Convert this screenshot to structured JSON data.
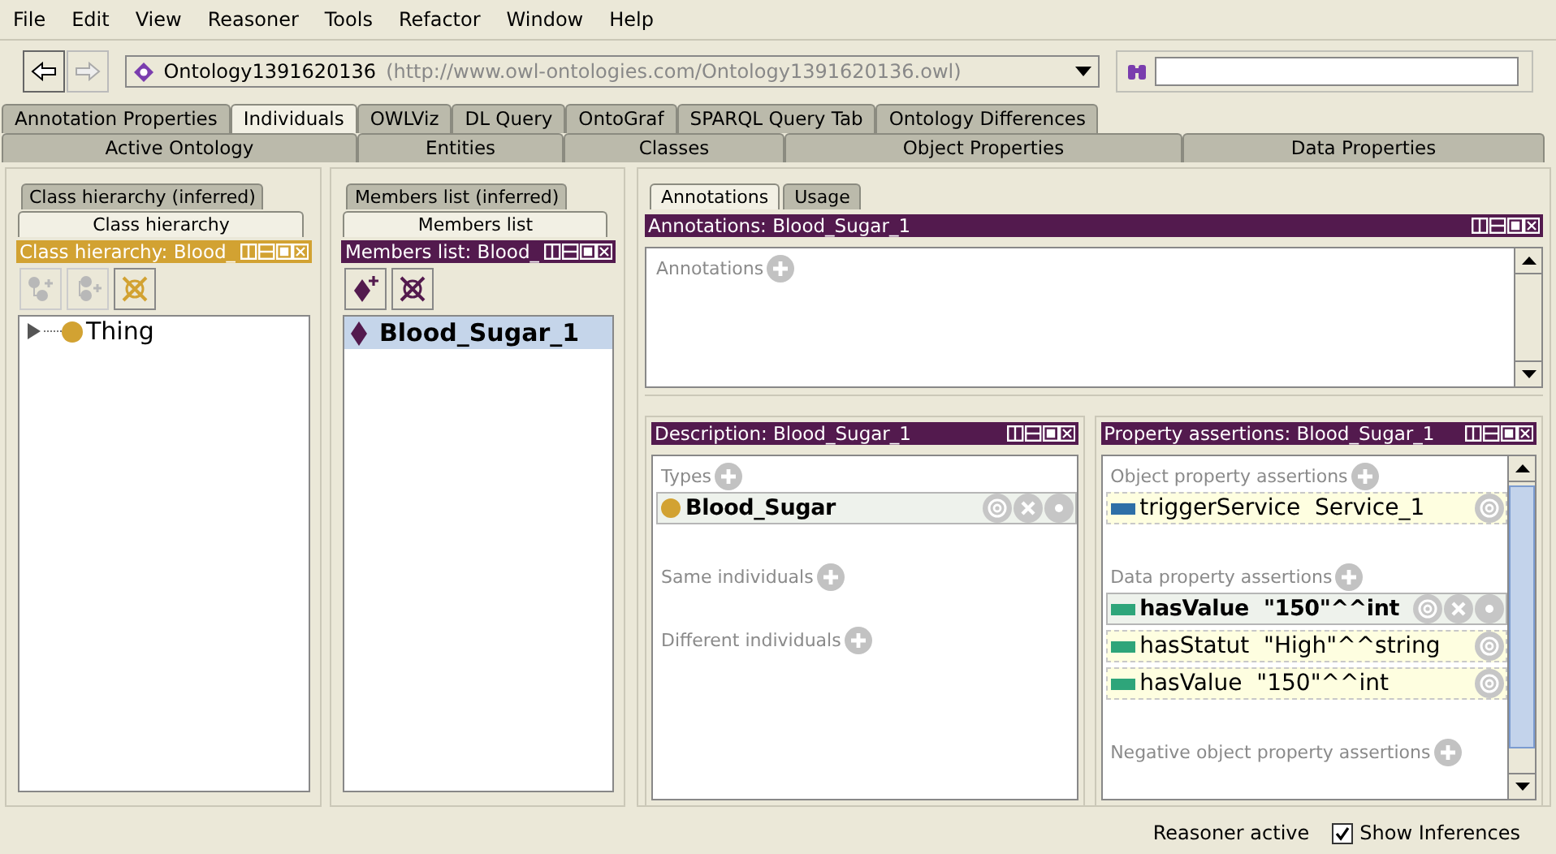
{
  "menu": [
    "File",
    "Edit",
    "View",
    "Reasoner",
    "Tools",
    "Refactor",
    "Window",
    "Help"
  ],
  "navigation": {
    "back": {
      "disabled": false
    },
    "forward": {
      "disabled": true
    }
  },
  "ontology": {
    "name": "Ontology1391620136",
    "iri": "(http://www.owl-ontologies.com/Ontology1391620136.owl)"
  },
  "tabs": [
    {
      "label": "Annotation Properties",
      "selected": false
    },
    {
      "label": "Individuals",
      "selected": true
    },
    {
      "label": "OWLViz",
      "selected": false
    },
    {
      "label": "DL Query",
      "selected": false
    },
    {
      "label": "OntoGraf",
      "selected": false
    },
    {
      "label": "SPARQL Query Tab",
      "selected": false
    },
    {
      "label": "Ontology Differences",
      "selected": false
    }
  ],
  "subtabs": [
    {
      "label": "Active Ontology",
      "selected": false
    },
    {
      "label": "Entities",
      "selected": false
    },
    {
      "label": "Classes",
      "selected": false
    },
    {
      "label": "Object Properties",
      "selected": false
    },
    {
      "label": "Data Properties",
      "selected": false
    }
  ],
  "class_hierarchy": {
    "tabs": [
      {
        "label": "Class hierarchy (inferred)",
        "selected": false
      },
      {
        "label": "Class hierarchy",
        "selected": true
      }
    ],
    "title": "Class hierarchy: Blood_",
    "tools": [
      {
        "kind": "add-subclass",
        "disabled": true
      },
      {
        "kind": "add-sibling",
        "disabled": true
      },
      {
        "kind": "delete",
        "disabled": false
      }
    ],
    "tree": [
      {
        "label": "Thing",
        "expanded": false
      }
    ]
  },
  "members": {
    "tabs": [
      {
        "label": "Members list (inferred)",
        "selected": false
      },
      {
        "label": "Members list",
        "selected": true
      }
    ],
    "title": "Members list: Blood_",
    "tools": [
      {
        "kind": "add",
        "disabled": false
      },
      {
        "kind": "delete",
        "disabled": false
      }
    ],
    "items": [
      {
        "label": "Blood_Sugar_1",
        "selected": true
      }
    ]
  },
  "annotations": {
    "tabs": [
      {
        "label": "Annotations",
        "selected": true
      },
      {
        "label": "Usage",
        "selected": false
      }
    ],
    "title": "Annotations: Blood_Sugar_1",
    "sections": [
      {
        "label": "Annotations"
      }
    ]
  },
  "description": {
    "title": "Description: Blood_Sugar_1",
    "sections": [
      {
        "label": "Types",
        "items": [
          {
            "kind": "class",
            "text": "Blood_Sugar",
            "selected": true
          }
        ]
      },
      {
        "label": "Same individuals"
      },
      {
        "label": "Different individuals"
      }
    ]
  },
  "property_assertions": {
    "title": "Property assertions: Blood_Sugar_1",
    "sections": [
      {
        "label": "Object property assertions",
        "items": [
          {
            "kind": "object",
            "text": "triggerService  Service_1",
            "selected": false
          }
        ]
      },
      {
        "label": "Data property assertions",
        "items": [
          {
            "kind": "data",
            "text": "hasValue  \"150\"^^int",
            "selected": true
          },
          {
            "kind": "data",
            "text": "hasStatut  \"High\"^^string",
            "selected": false
          },
          {
            "kind": "data",
            "text": "hasValue  \"150\"^^int",
            "selected": false
          }
        ]
      },
      {
        "label": "Negative object property assertions"
      }
    ]
  },
  "status_bar": {
    "text": "Reasoner active",
    "show_inferences": {
      "label": "Show Inferences",
      "checked": true
    }
  }
}
